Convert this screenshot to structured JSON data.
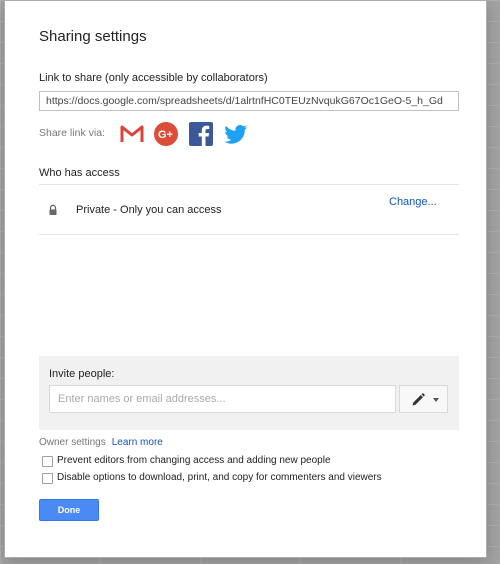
{
  "dialog": {
    "title": "Sharing settings",
    "link_section": {
      "label": "Link to share (only accessible by collaborators)",
      "url": "https://docs.google.com/spreadsheets/d/1alrtnfHC0TEUzNvqukG67Oc1GeO-5_h_Gd"
    },
    "share_via": {
      "label": "Share link via:",
      "services": [
        "gmail-icon",
        "google-plus-icon",
        "facebook-icon",
        "twitter-icon"
      ]
    },
    "access": {
      "label": "Who has access",
      "entry": "Private - Only you can access",
      "change_label": "Change..."
    },
    "invite": {
      "label": "Invite people:",
      "placeholder": "Enter names or email addresses...",
      "permission_icon": "pencil-icon"
    },
    "owner_settings": {
      "label": "Owner settings",
      "learn_more": "Learn more",
      "options": [
        {
          "label": "Prevent editors from changing access and adding new people",
          "checked": false
        },
        {
          "label": "Disable options to download, print, and copy for commenters and viewers",
          "checked": false
        }
      ]
    },
    "done_label": "Done"
  },
  "colors": {
    "primary_button": "#4a8af4",
    "link": "#1155cc",
    "gmail": "#db4437",
    "google_plus": "#dd4b39",
    "facebook": "#3b5998",
    "twitter": "#1da1f2"
  }
}
